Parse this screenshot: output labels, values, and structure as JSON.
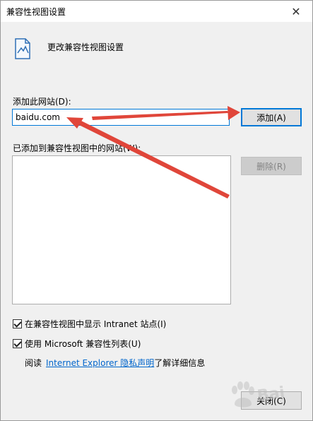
{
  "window": {
    "title": "兼容性视图设置",
    "close_glyph": "✕"
  },
  "header": {
    "text": "更改兼容性视图设置"
  },
  "add_section": {
    "label": "添加此网站(D):",
    "input_value": "baidu.com",
    "add_button": "添加(A)"
  },
  "list_section": {
    "label": "已添加到兼容性视图中的网站(W):",
    "remove_button": "删除(R)",
    "items": []
  },
  "options": {
    "intranet_label": "在兼容性视图中显示 Intranet 站点(I)",
    "intranet_checked": true,
    "ms_list_label": "使用 Microsoft 兼容性列表(U)",
    "ms_list_checked": true
  },
  "info": {
    "prefix": "阅读",
    "link_text": "Internet Explorer 隐私声明",
    "suffix": "了解详细信息"
  },
  "footer": {
    "close_button": "关闭(C)"
  },
  "colors": {
    "accent": "#0078d7",
    "annotation_arrow": "#e0463a"
  }
}
